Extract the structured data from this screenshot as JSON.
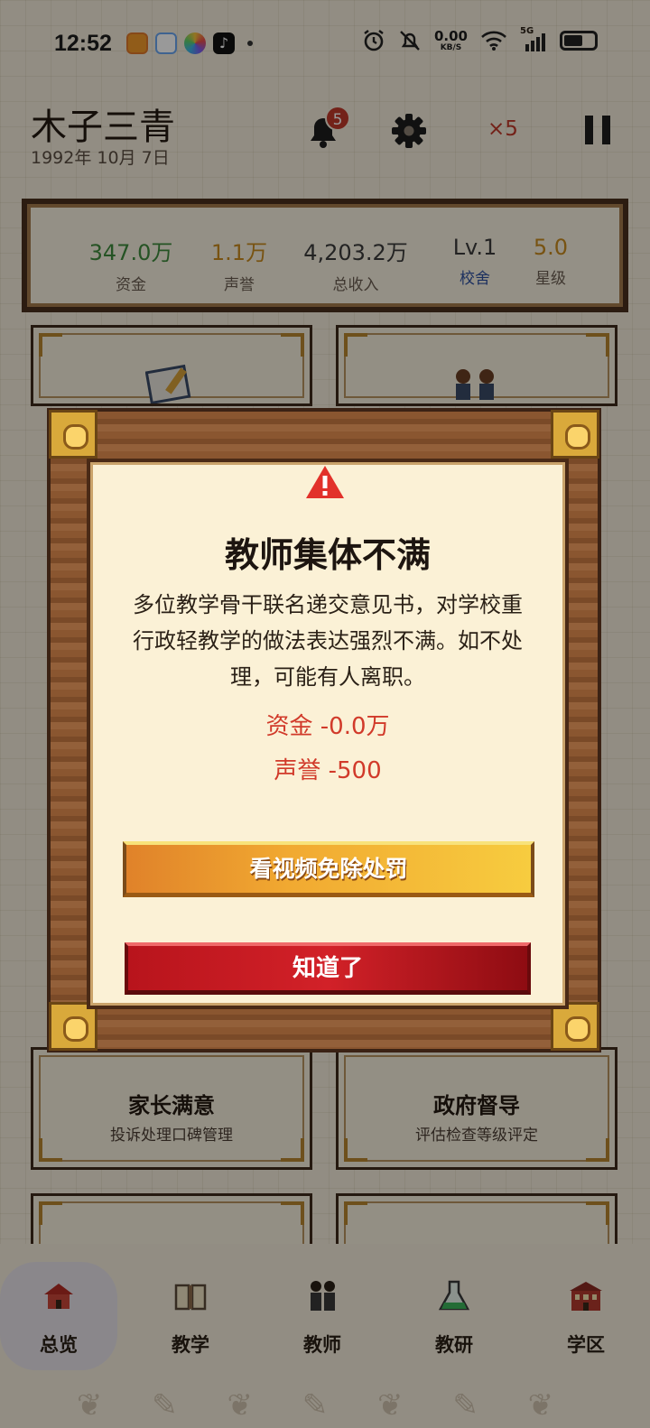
{
  "status_bar": {
    "time": "12:52",
    "net_speed_value": "0.00",
    "net_speed_unit": "KB/S",
    "signal_label": "5G",
    "icons": [
      "app-notification-icon",
      "cloud-app-icon",
      "photos-icon",
      "tiktok-icon",
      "alarm-icon",
      "mute-icon",
      "wifi-icon",
      "cell-signal-icon",
      "battery-icon"
    ]
  },
  "header": {
    "school_name": "木子三青",
    "date": "1992年 10月 7日",
    "notification_count": "5",
    "speed": "×5"
  },
  "stats": [
    {
      "value": "347.0万",
      "label": "资金",
      "value_color": "#3f8a3c",
      "label_color": "#6a5d50"
    },
    {
      "value": "1.1万",
      "label": "声誉",
      "value_color": "#c88a1e",
      "label_color": "#6a5d50"
    },
    {
      "value": "4,203.2万",
      "label": "总收入",
      "value_color": "#3b3b3b",
      "label_color": "#6a5d50"
    },
    {
      "value": "Lv.1",
      "label": "校舍",
      "value_color": "#3b3b3b",
      "label_color": "#2d4f9e"
    },
    {
      "value": "5.0",
      "label": "星级",
      "value_color": "#c88a1e",
      "label_color": "#6a5d50"
    }
  ],
  "cards": {
    "parents": {
      "title": "家长满意",
      "subtitle": "投诉处理口碑管理"
    },
    "government": {
      "title": "政府督导",
      "subtitle": "评估检查等级评定"
    }
  },
  "dialog": {
    "title": "教师集体不满",
    "body": "多位教学骨干联名递交意见书，对学校重行政轻教学的做法表达强烈不满。如不处理，可能有人离职。",
    "cost_funds": "资金 -0.0万",
    "cost_reputation": "声誉 -500",
    "video_button": "看视频免除处罚",
    "ok_button": "知道了"
  },
  "bottom_nav": [
    {
      "label": "总览",
      "icon": "school-house-icon",
      "active": true
    },
    {
      "label": "教学",
      "icon": "book-icon",
      "active": false
    },
    {
      "label": "教师",
      "icon": "teachers-icon",
      "active": false
    },
    {
      "label": "教研",
      "icon": "flask-icon",
      "active": false
    },
    {
      "label": "学区",
      "icon": "district-building-icon",
      "active": false
    }
  ]
}
